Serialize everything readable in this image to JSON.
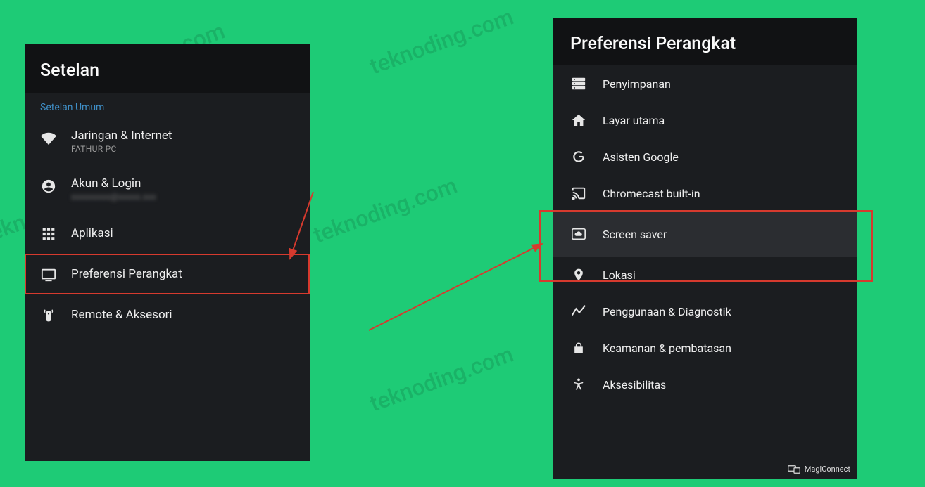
{
  "watermark_text": "teknoding.com",
  "left_panel": {
    "title": "Setelan",
    "section": "Setelan Umum",
    "items": [
      {
        "id": "network",
        "label": "Jaringan & Internet",
        "sublabel": "FATHUR PC"
      },
      {
        "id": "account",
        "label": "Akun & Login"
      },
      {
        "id": "apps",
        "label": "Aplikasi"
      },
      {
        "id": "device",
        "label": "Preferensi Perangkat"
      },
      {
        "id": "remote",
        "label": "Remote & Aksesori"
      }
    ]
  },
  "right_panel": {
    "title": "Preferensi Perangkat",
    "items": [
      {
        "id": "storage",
        "label": "Penyimpanan"
      },
      {
        "id": "home",
        "label": "Layar utama"
      },
      {
        "id": "assistant",
        "label": "Asisten Google"
      },
      {
        "id": "chromecast",
        "label": "Chromecast built-in"
      },
      {
        "id": "screensaver",
        "label": "Screen saver"
      },
      {
        "id": "location",
        "label": "Lokasi"
      },
      {
        "id": "usage",
        "label": "Penggunaan & Diagnostik"
      },
      {
        "id": "security",
        "label": "Keamanan & pembatasan"
      },
      {
        "id": "accessibility",
        "label": "Aksesibilitas"
      }
    ],
    "footer_badge": "MagiConnect"
  }
}
